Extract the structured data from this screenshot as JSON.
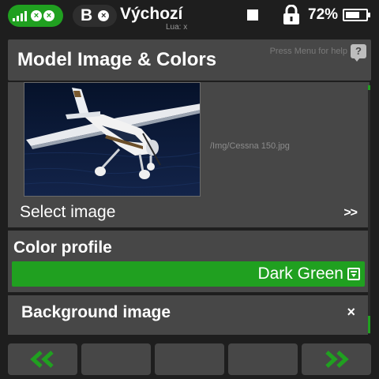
{
  "status": {
    "radio_letter": "B",
    "model_name": "Výchozí",
    "lua_text": "Lua: x",
    "battery_percent_label": "72%",
    "battery_level": 0.72,
    "icons": [
      "signal-icon",
      "telemetry-off-icon",
      "rf-off-icon",
      "receiver-off-icon",
      "stop-square-icon",
      "lock-icon",
      "battery-icon"
    ]
  },
  "header": {
    "title": "Model Image & Colors",
    "help_text": "Press Menu for help",
    "help_icon_glyph": "?"
  },
  "image_section": {
    "path": "/Img/Cessna 150.jpg",
    "select_label": "Select image",
    "chevron": ">>"
  },
  "color_profile": {
    "label": "Color profile",
    "value": "Dark Green"
  },
  "background_image": {
    "label": "Background image",
    "clear_glyph": "×"
  },
  "nav": {
    "buttons": [
      "previous-page",
      "",
      "",
      "",
      "next-page"
    ]
  },
  "colors": {
    "accent": "#20a020",
    "panel": "#474747",
    "background": "#1e1e1e"
  }
}
